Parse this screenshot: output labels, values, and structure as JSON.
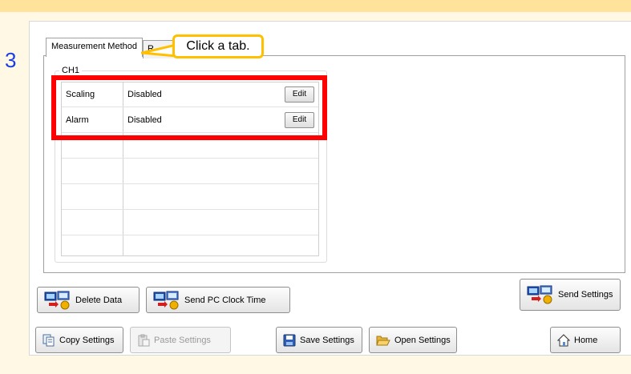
{
  "step": {
    "number": "3"
  },
  "tabs": [
    {
      "label": "Measurement Method"
    },
    {
      "label": "R"
    }
  ],
  "callout": {
    "text": "Click a tab."
  },
  "group": {
    "label": "CH1",
    "rows": [
      {
        "name": "Scaling",
        "value": "Disabled",
        "button": "Edit"
      },
      {
        "name": "Alarm",
        "value": "Disabled",
        "button": "Edit"
      }
    ]
  },
  "buttons": {
    "delete_data": "Delete Data",
    "send_pc_clock_time": "Send PC Clock Time",
    "send_settings": "Send Settings",
    "copy_settings": "Copy Settings",
    "paste_settings": "Paste Settings",
    "save_settings": "Save Settings",
    "open_settings": "Open Settings",
    "home": "Home"
  },
  "colors": {
    "highlight": "#ff0000",
    "callout_border": "#ffc000",
    "step_number": "#1a3ee6",
    "header_band": "#ffe39a"
  },
  "icons": {
    "delete_data": "computer-transfer-icon",
    "send_pc_clock_time": "computer-transfer-icon",
    "send_settings": "computer-transfer-icon",
    "copy_settings": "copy-icon",
    "paste_settings": "paste-icon",
    "save_settings": "floppy-disk-icon",
    "open_settings": "folder-open-icon",
    "home": "home-icon"
  }
}
